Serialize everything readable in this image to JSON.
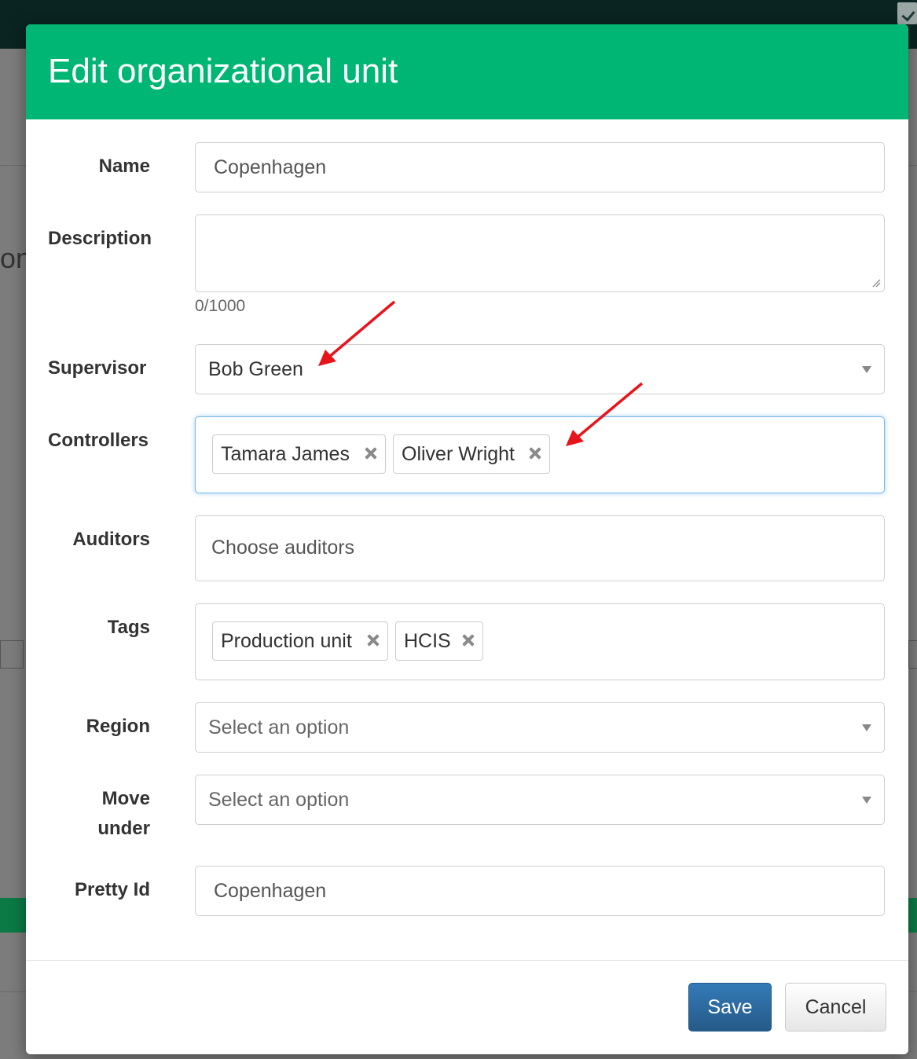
{
  "background": {
    "partial_heading": "on"
  },
  "modal": {
    "title": "Edit organizational unit",
    "fields": {
      "name": {
        "label": "Name",
        "value": "Copenhagen"
      },
      "description": {
        "label": "Description",
        "value": "",
        "char_count": "0/1000"
      },
      "supervisor": {
        "label": "Supervisor",
        "value": "Bob Green"
      },
      "controllers": {
        "label": "Controllers",
        "tags": [
          "Tamara James",
          "Oliver Wright"
        ]
      },
      "auditors": {
        "label": "Auditors",
        "placeholder": "Choose auditors"
      },
      "tags": {
        "label": "Tags",
        "tags": [
          "Production unit",
          "HCIS"
        ]
      },
      "region": {
        "label": "Region",
        "placeholder": "Select an option"
      },
      "move_under": {
        "label_line1": "Move",
        "label_line2": "under",
        "placeholder": "Select an option"
      },
      "pretty_id": {
        "label": "Pretty Id",
        "value": "Copenhagen"
      }
    },
    "buttons": {
      "save": "Save",
      "cancel": "Cancel"
    }
  },
  "colors": {
    "header": "#00b674",
    "primary_button": "#2e6da4",
    "annotation_arrow": "#e8141b"
  },
  "icons": [
    "remove-tag-icon",
    "dropdown-caret-icon",
    "resize-grip-icon",
    "checkmark-icon",
    "annotation-arrow"
  ]
}
